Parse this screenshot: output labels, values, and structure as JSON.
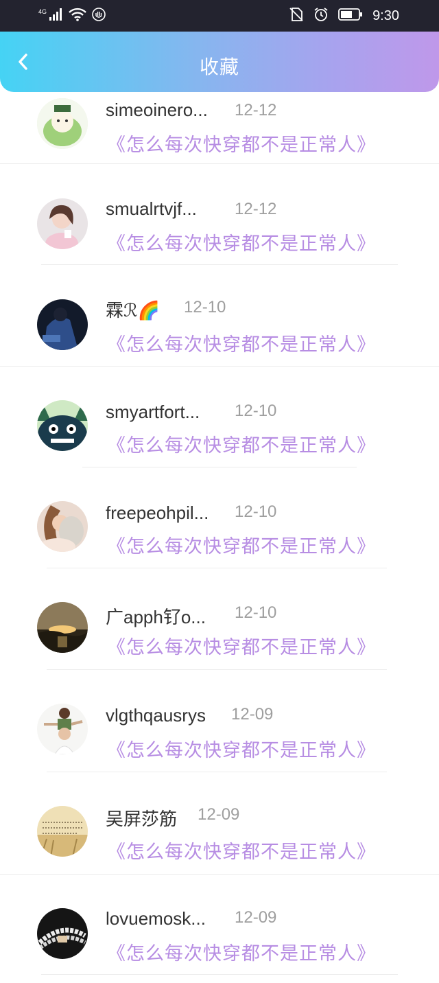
{
  "status_bar": {
    "network": "4G",
    "time": "9:30"
  },
  "header": {
    "title": "收藏",
    "back_icon": "chevron-left-icon"
  },
  "items": [
    {
      "username": "simeoinero...",
      "date": "12-12",
      "book": "《怎么每次快穿都不是正常人》"
    },
    {
      "username": "smualrtvjf...",
      "date": "12-12",
      "book": "《怎么每次快穿都不是正常人》"
    },
    {
      "username": "霖ℛ🌈",
      "date": "12-10",
      "book": "《怎么每次快穿都不是正常人》"
    },
    {
      "username": "smyartfort...",
      "date": "12-10",
      "book": "《怎么每次快穿都不是正常人》"
    },
    {
      "username": "freepeohpil...",
      "date": "12-10",
      "book": "《怎么每次快穿都不是正常人》"
    },
    {
      "username": "广apph钌o...",
      "date": "12-10",
      "book": "《怎么每次快穿都不是正常人》"
    },
    {
      "username": "vlgthqausrys",
      "date": "12-09",
      "book": "《怎么每次快穿都不是正常人》"
    },
    {
      "username": "吴屏莎筋",
      "date": "12-09",
      "book": "《怎么每次快穿都不是正常人》"
    },
    {
      "username": "lovuemosk...",
      "date": "12-09",
      "book": "《怎么每次快穿都不是正常人》"
    }
  ]
}
